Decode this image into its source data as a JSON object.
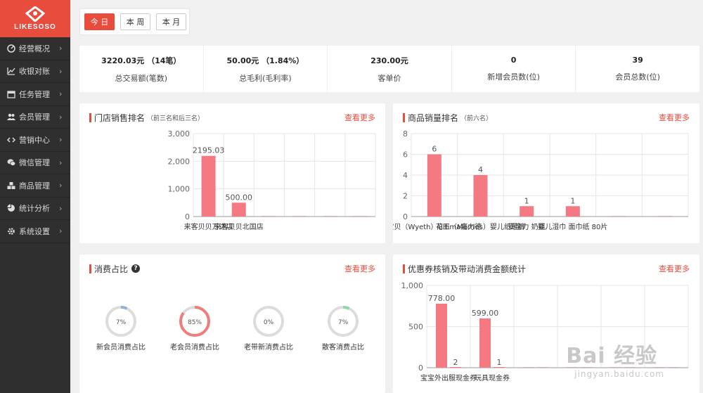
{
  "brand": {
    "logo_text": "LIKESOSO"
  },
  "sidebar": {
    "items": [
      {
        "label": "经营概况",
        "icon": "dashboard-icon"
      },
      {
        "label": "收银对账",
        "icon": "line-chart-icon"
      },
      {
        "label": "任务管理",
        "icon": "calendar-icon"
      },
      {
        "label": "会员管理",
        "icon": "users-icon"
      },
      {
        "label": "营销中心",
        "icon": "code-icon"
      },
      {
        "label": "微信管理",
        "icon": "wechat-icon"
      },
      {
        "label": "商品管理",
        "icon": "cubes-icon"
      },
      {
        "label": "统计分析",
        "icon": "pie-chart-icon"
      },
      {
        "label": "系统设置",
        "icon": "gear-icon"
      }
    ]
  },
  "period_tabs": [
    {
      "label": "今 日",
      "active": true
    },
    {
      "label": "本 周",
      "active": false
    },
    {
      "label": "本 月",
      "active": false
    }
  ],
  "stats": [
    {
      "value": "3220.03元 （14笔）",
      "label": "总交易额(笔数)"
    },
    {
      "value": "50.00元 （1.84%）",
      "label": "总毛利(毛利率)"
    },
    {
      "value": "230.00元",
      "label": "客单价"
    },
    {
      "value": "0",
      "label": "新增会员数(位)"
    },
    {
      "value": "39",
      "label": "会员总数(位)"
    }
  ],
  "panels": {
    "store_rank": {
      "title": "门店销售排名",
      "subtitle": "（前三名和后三名）",
      "more": "查看更多"
    },
    "product_rank": {
      "title": "商品销量排名",
      "subtitle": "（前六名）",
      "more": "查看更多"
    },
    "consume_ratio": {
      "title": "消费占比",
      "more": "查看更多"
    },
    "coupon_stats": {
      "title": "优惠券核销及带动消费金额统计",
      "more": "查看更多"
    }
  },
  "bar_color": "#f47983",
  "chart_data": [
    {
      "type": "bar",
      "categories": [
        "来客贝贝万达店",
        "来客贝贝北国店",
        "",
        "",
        "",
        ""
      ],
      "values": [
        2195.03,
        500.0,
        0,
        0,
        0,
        0
      ],
      "data_labels": [
        "2195.03",
        "500.00",
        "",
        "",
        "",
        ""
      ],
      "yticks": [
        "0",
        "1,000",
        "2,000",
        "3,000"
      ],
      "ylim": [
        0,
        3000
      ]
    },
    {
      "type": "bar",
      "categories": [
        "宝贝（Wyeth）Ultima嘉力德",
        "花王（Merries）婴儿纸尿裤",
        "安宝力 奶瓶",
        "婴儿湿巾 面巾纸 80片",
        "",
        ""
      ],
      "values": [
        6,
        4,
        1,
        1,
        0,
        0
      ],
      "data_labels": [
        "6",
        "4",
        "1",
        "1",
        "",
        ""
      ],
      "yticks": [
        "0",
        "2",
        "4",
        "6",
        "8"
      ],
      "ylim": [
        0,
        8
      ]
    },
    {
      "type": "pie",
      "items": [
        {
          "label": "新会员消费占比",
          "value": 7,
          "text": "7%",
          "color": "#8fb3d9"
        },
        {
          "label": "老会员消费占比",
          "value": 85,
          "text": "85%",
          "color": "#f07c7c"
        },
        {
          "label": "老带新消费占比",
          "value": 0,
          "text": "0%",
          "color": "#cccccc"
        },
        {
          "label": "散客消费占比",
          "value": 7,
          "text": "7%",
          "color": "#8ed8a6"
        }
      ]
    },
    {
      "type": "bar",
      "categories": [
        "宝宝外出服现金券",
        "玩具现金券",
        "",
        "",
        "",
        ""
      ],
      "series": [
        {
          "values": [
            778.0,
            599.0,
            0,
            0,
            0,
            0
          ],
          "data_labels": [
            "778.00",
            "599.00",
            "",
            "",
            "",
            ""
          ]
        },
        {
          "values": [
            2,
            1,
            0,
            0,
            0,
            0
          ],
          "data_labels": [
            "2",
            "1",
            "",
            "",
            "",
            ""
          ]
        }
      ],
      "yticks": [
        "0",
        "500",
        "1,000"
      ],
      "ylim": [
        0,
        1000
      ]
    }
  ],
  "watermark": {
    "main": "Bai 经验",
    "sub": "jingyan.baidu.com"
  }
}
